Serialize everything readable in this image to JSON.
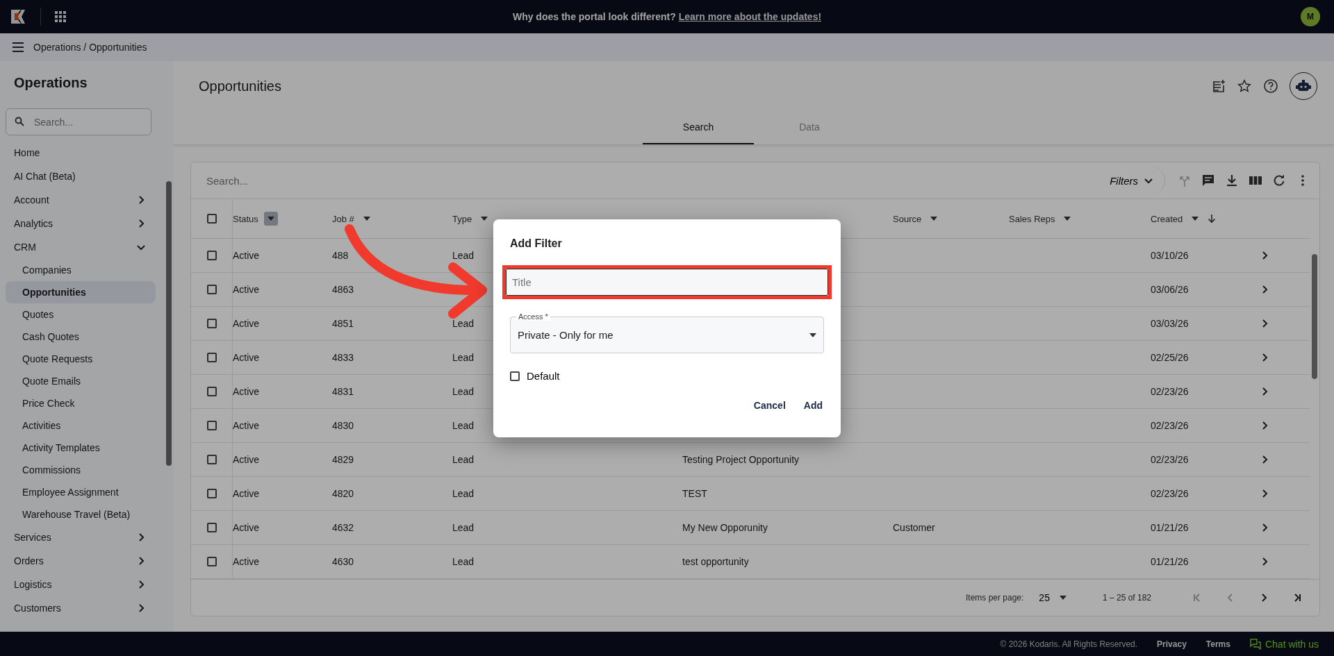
{
  "banner": {
    "text": "Why does the portal look different? ",
    "link": "Learn more about the updates!"
  },
  "avatar": {
    "initial": "M"
  },
  "breadcrumb": "Operations / Opportunities",
  "sidebar": {
    "title": "Operations",
    "search": {
      "placeholder": "Search..."
    },
    "items": [
      {
        "label": "Home",
        "selected": false
      },
      {
        "label": "AI Chat (Beta)",
        "selected": false
      },
      {
        "label": "Account",
        "expanded": false,
        "selected": false
      },
      {
        "label": "Analytics",
        "expanded": false,
        "selected": false
      },
      {
        "label": "CRM",
        "expanded": true,
        "selected": false,
        "children": [
          {
            "label": "Companies",
            "selected": false
          },
          {
            "label": "Opportunities",
            "selected": true
          },
          {
            "label": "Quotes",
            "selected": false
          },
          {
            "label": "Cash Quotes",
            "selected": false
          },
          {
            "label": "Quote Requests",
            "selected": false
          },
          {
            "label": "Quote Emails",
            "selected": false
          },
          {
            "label": "Price Check",
            "selected": false
          },
          {
            "label": "Activities",
            "selected": false
          },
          {
            "label": "Activity Templates",
            "selected": false
          },
          {
            "label": "Commissions",
            "selected": false
          },
          {
            "label": "Employee Assignment",
            "selected": false
          },
          {
            "label": "Warehouse Travel (Beta)",
            "selected": false
          }
        ]
      },
      {
        "label": "Services",
        "expanded": false,
        "selected": false
      },
      {
        "label": "Orders",
        "expanded": false,
        "selected": false
      },
      {
        "label": "Logistics",
        "expanded": false,
        "selected": false
      },
      {
        "label": "Customers",
        "expanded": false,
        "selected": false
      }
    ]
  },
  "page": {
    "title": "Opportunities"
  },
  "tabs": [
    {
      "label": "Search",
      "selected": true
    },
    {
      "label": "Data",
      "selected": false
    }
  ],
  "table": {
    "search": {
      "placeholder": "Search..."
    },
    "filters_label": "Filters",
    "all_checked": false,
    "columns": [
      {
        "label": "Status",
        "highlighted": true
      },
      {
        "label": "Job #",
        "highlighted": false
      },
      {
        "label": "Type",
        "highlighted": false
      },
      {},
      {},
      {
        "label": "Source",
        "highlighted": false
      },
      {
        "label": "Sales Reps",
        "highlighted": false
      },
      {
        "label": "Created",
        "highlighted": false,
        "sorted": true
      }
    ],
    "rows": [
      {
        "status": "Active",
        "job": "488",
        "type": "Lead",
        "created": "03/10/26",
        "checked": false
      },
      {
        "status": "Active",
        "job": "4863",
        "created": "03/06/26",
        "checked": false
      },
      {
        "status": "Active",
        "job": "4851",
        "type": "Lead",
        "created": "03/03/26",
        "checked": false
      },
      {
        "status": "Active",
        "job": "4833",
        "type": "Lead",
        "created": "02/25/26",
        "checked": false
      },
      {
        "status": "Active",
        "job": "4831",
        "type": "Lead",
        "created": "02/23/26",
        "checked": false
      },
      {
        "status": "Active",
        "job": "4830",
        "type": "Lead",
        "created": "02/23/26",
        "checked": false
      },
      {
        "status": "Active",
        "job": "4829",
        "type": "Lead",
        "name": "Testing Project Opportunity",
        "created": "02/23/26",
        "checked": false
      },
      {
        "status": "Active",
        "job": "4820",
        "type": "Lead",
        "name": "TEST",
        "created": "02/23/26",
        "checked": false
      },
      {
        "status": "Active",
        "job": "4632",
        "type": "Lead",
        "name": "My New Opporunity",
        "source": "Customer",
        "created": "01/21/26",
        "checked": false
      },
      {
        "status": "Active",
        "job": "4630",
        "type": "Lead",
        "name": "test opportunity",
        "created": "01/21/26",
        "checked": false
      }
    ],
    "paginator": {
      "items_label": "Items per page:",
      "page_size": "25",
      "range": "1 – 25 of 182",
      "buttons": [
        {
          "kind": "first",
          "disabled": true
        },
        {
          "kind": "prev",
          "disabled": true
        },
        {
          "kind": "next",
          "disabled": false
        },
        {
          "kind": "last",
          "disabled": false
        }
      ]
    }
  },
  "dialog": {
    "title": "Add Filter",
    "title_field": {
      "placeholder": "Title"
    },
    "access": {
      "label": "Access *",
      "value": "Private - Only for me"
    },
    "default": {
      "label": "Default",
      "checked": false
    },
    "buttons": [
      "Cancel",
      "Add"
    ]
  },
  "footer": {
    "copyright": "© 2026 Kodaris. All Rights Reserved.",
    "links": [
      "Privacy",
      "Terms"
    ],
    "chat": "Chat with us"
  }
}
